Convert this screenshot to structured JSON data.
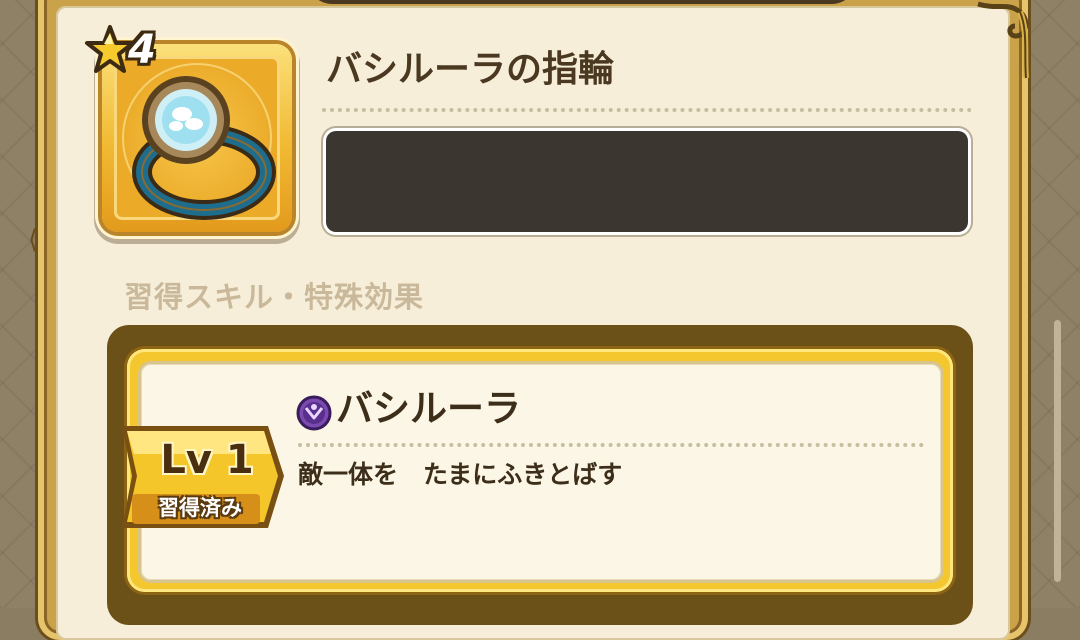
{
  "item": {
    "rarity": "4",
    "name": "バシルーラの指輪",
    "icon": "ring-icon"
  },
  "section": {
    "label": "習得スキル・特殊効果"
  },
  "skill": {
    "icon": "skill-type-icon",
    "name": "バシルーラ",
    "description": "敵一体を　たまにふきとばす",
    "level": "Lv 1",
    "status": "習得済み"
  },
  "colors": {
    "panel_gold": "#c9a24a",
    "card_cream": "#f6eed9",
    "text_brown": "#4a3820",
    "desc_box": "#3b3730",
    "skill_icon_purple": "#6a3a9c"
  }
}
